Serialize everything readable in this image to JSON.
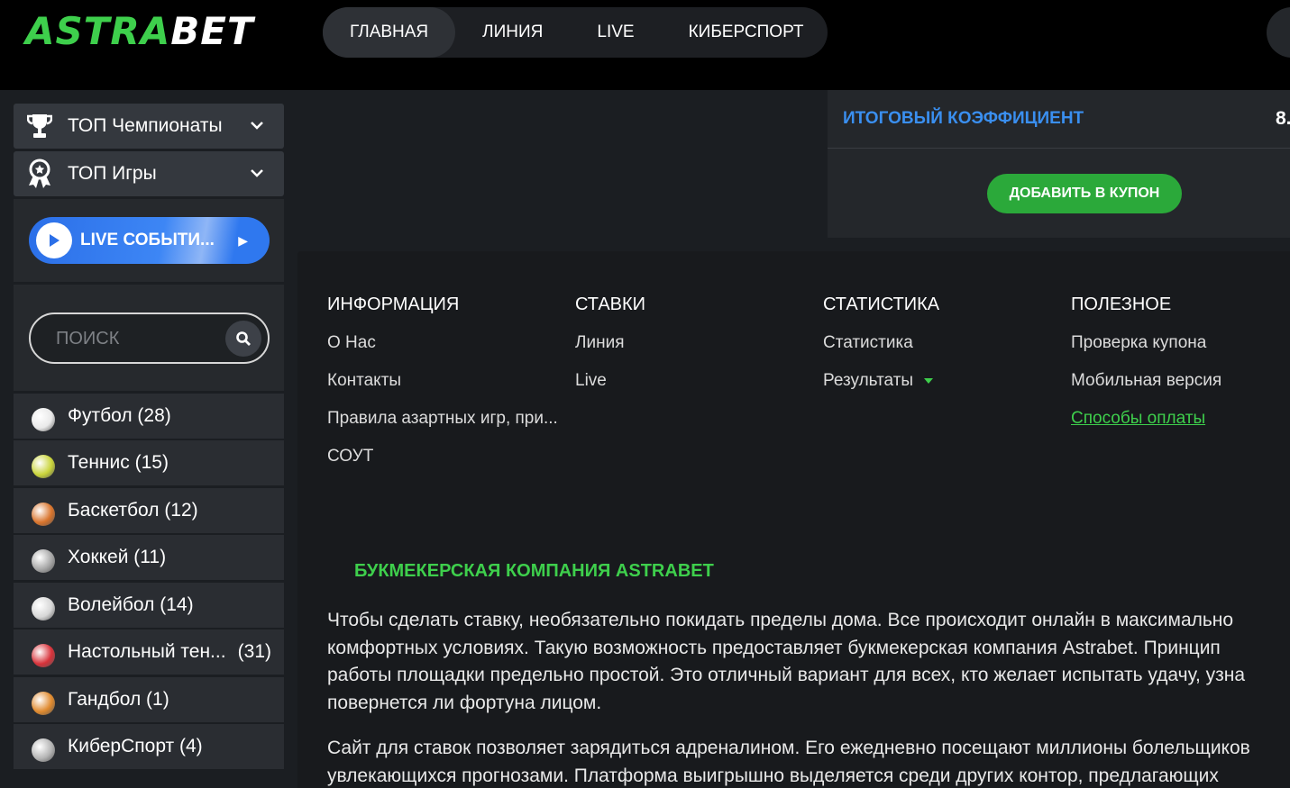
{
  "header": {
    "logo_part1": "ASTRA",
    "logo_part2": "BET",
    "nav": [
      "ГЛАВНАЯ",
      "ЛИНИЯ",
      "LIVE",
      "КИБЕРСПОРТ"
    ]
  },
  "sidebar": {
    "top_championships": "ТОП Чемпионаты",
    "top_games": "ТОП Игры",
    "live_button": "LIVE СОБЫТИ...",
    "search_placeholder": "ПОИСК",
    "sports": [
      {
        "name": "Футбол (28)",
        "icon": "soccer-ball-icon",
        "color": "#e9e9e9"
      },
      {
        "name": "Теннис (15)",
        "icon": "tennis-ball-icon",
        "color": "#c9d43a"
      },
      {
        "name": "Баскетбол (12)",
        "icon": "basketball-icon",
        "color": "#d9742c"
      },
      {
        "name": "Хоккей (11)",
        "icon": "skate-icon",
        "color": "#a8a8a8"
      },
      {
        "name": "Волейбол (14)",
        "icon": "volleyball-icon",
        "color": "#d7d7d7"
      },
      {
        "name": "Настольный тен...",
        "count": "(31)",
        "icon": "table-tennis-icon",
        "color": "#d8323a"
      },
      {
        "name": "Гандбол (1)",
        "icon": "handball-icon",
        "color": "#e08a2e"
      },
      {
        "name": "КиберСпорт (4)",
        "icon": "gamepad-icon",
        "color": "#b5b5b5"
      }
    ]
  },
  "coupon": {
    "total_label": "ИТОГОВЫЙ КОЭФФИЦИЕНТ",
    "total_value": "8.",
    "add_button": "ДОБАВИТЬ В КУПОН"
  },
  "footer_menu": {
    "info": {
      "title": "ИНФОРМАЦИЯ",
      "links": [
        "О Нас",
        "Контакты",
        "Правила азартных игр, при...",
        "СОУТ"
      ]
    },
    "bets": {
      "title": "СТАВКИ",
      "links": [
        "Линия",
        "Live"
      ]
    },
    "stats": {
      "title": "СТАТИСТИКА",
      "links": [
        "Статистика",
        "Результаты"
      ]
    },
    "useful": {
      "title": "ПОЛЕЗНОЕ",
      "links": [
        "Проверка купона",
        "Мобильная версия",
        "Способы оплаты"
      ]
    }
  },
  "about": {
    "title": "БУКМЕКЕРСКАЯ КОМПАНИЯ ASTRABET",
    "p1": [
      "Чтобы сделать ставку, необязательно покидать пределы дома. Все происходит онлайн в максимально",
      "комфортных условиях. Такую возможность предоставляет букмекерская компания Astrabet. Принцип",
      "работы площадки предельно простой. Это отличный вариант для всех, кто желает испытать удачу, узна",
      "повернется ли фортуна лицом."
    ],
    "p2": [
      "Сайт для ставок позволяет зарядиться адреналином. Его ежедневно посещают миллионы болельщиков",
      "увлекающихся прогнозами. Платформа выигрышно выделяется среди других контор, предлагающих"
    ]
  },
  "colors": {
    "accent_green": "#3ecf4c",
    "accent_blue": "#3a8ff0",
    "button_green": "#2ba93a"
  }
}
